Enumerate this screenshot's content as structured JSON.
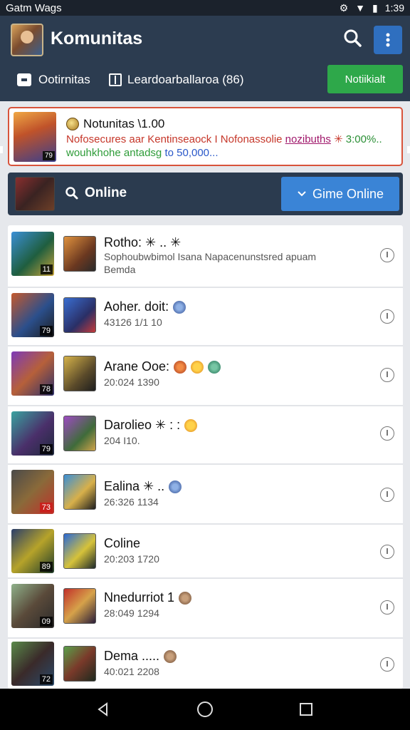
{
  "status_bar": {
    "title": "Gatm Wags",
    "time": "1:39"
  },
  "header": {
    "title": "Komunitas",
    "tab_1": "Ootirnitas",
    "tab_2": "Leardoarballaroa (86)",
    "notif_button": "Notiikialt"
  },
  "promo": {
    "badge": "79",
    "title": "Notunitas \\1.00",
    "line1_a": "Nofosecures aar Kentinseaock I Nofonassolie ",
    "line1_link": "nozibuths",
    "line1_b": " ✳ ",
    "line1_green": "3:00%..",
    "line2_a": "wouhkhohe antadsg ",
    "line2_blue": "to 50,000..."
  },
  "online_bar": {
    "label": "Online",
    "button": "Gime Online"
  },
  "rows": [
    {
      "name": "Rotho: ✳ .. ✳",
      "sub": "Sophoubwbimol Isana Napacenunstsred apuam",
      "sub2": "Bemda",
      "level": "11"
    },
    {
      "name": "Aoher. doit:",
      "sub": "43126 1/1 10",
      "level": "79"
    },
    {
      "name": "Arane Ooe:",
      "sub": "20:024 1390",
      "level": "78"
    },
    {
      "name": "Darolieo ✳ : :",
      "sub": "204 I10.",
      "level": "79"
    },
    {
      "name": "Ealina ✳ ..",
      "sub": "26:326 1134",
      "level": "73"
    },
    {
      "name": "Coline",
      "sub": "20:203 1720",
      "level": "89"
    },
    {
      "name": "Nnedurriot 1",
      "sub": "28:049 1294",
      "level": "09"
    },
    {
      "name": "Dema .....",
      "sub": "40:021 2208",
      "level": "72"
    }
  ],
  "colors": {
    "header_bg": "#2c3c50",
    "accent_blue": "#3a84d6",
    "accent_green": "#2ea84a",
    "promo_border": "#d8533b"
  }
}
